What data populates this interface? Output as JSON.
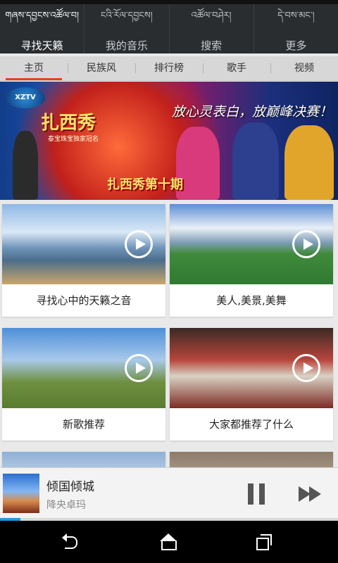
{
  "top_nav": {
    "items": [
      {
        "tibetan": "གཞས་དབྱངས་འཚོལ་བ།",
        "label": "寻找天籁"
      },
      {
        "tibetan": "ངའི་རོལ་དབྱངས།",
        "label": "我的音乐"
      },
      {
        "tibetan": "འཚོལ་བཤེར།",
        "label": "搜索"
      },
      {
        "tibetan": "དེ་བས་མང་།",
        "label": "更多"
      }
    ],
    "active_index": 0
  },
  "tabs": {
    "items": [
      "主页",
      "民族风",
      "排行榜",
      "歌手",
      "视频"
    ],
    "active_index": 0
  },
  "banner": {
    "logo_text": "XZTV",
    "show_title": "扎西秀",
    "sponsor": "泰宝珠宝独家冠名",
    "slogan": "放心灵表白，放巅峰决赛！",
    "episode": "扎西秀第十期"
  },
  "cards": [
    {
      "caption": "寻找心中的天籁之音",
      "icon": "play-icon"
    },
    {
      "caption": "美人,美景,美舞",
      "icon": "play-icon"
    },
    {
      "caption": "新歌推荐",
      "icon": "play-icon"
    },
    {
      "caption": "大家都推荐了什么",
      "icon": "play-icon"
    }
  ],
  "player": {
    "song": "倾国倾城",
    "artist": "降央卓玛",
    "progress": 0.06,
    "icons": [
      "pause-icon",
      "next-icon"
    ]
  },
  "system_nav": {
    "icons": [
      "back-icon",
      "home-icon",
      "recent-apps-icon"
    ]
  },
  "colors": {
    "accent": "#e0431f",
    "progress": "#1e9be0",
    "nav_bg": "#2a2d30"
  }
}
